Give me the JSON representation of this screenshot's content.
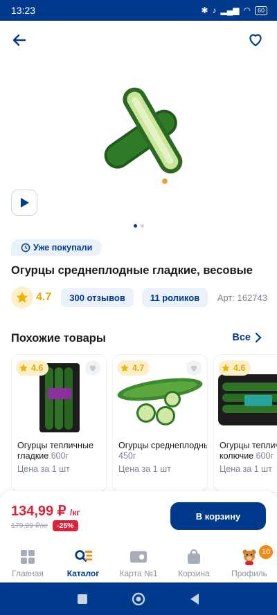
{
  "status": {
    "time": "13:23",
    "battery": "60"
  },
  "product": {
    "bought_label": "Уже покупали",
    "title": "Огурцы среднеплодные гладкие, весовые",
    "rating": "4.7",
    "reviews": "300 отзывов",
    "videos": "11 роликов",
    "article": "Арт: 162743"
  },
  "similar": {
    "title": "Похожие товары",
    "all_label": "Все",
    "cards": [
      {
        "rating": "4.6",
        "name": "Огурцы тепличные гладкие",
        "weight": "600г",
        "price_label": "Цена за 1 шт"
      },
      {
        "rating": "4.7",
        "name": "Огурцы среднеплодные",
        "weight": "450г",
        "price_label": "Цена за 1 шт"
      },
      {
        "rating": "4.6",
        "name": "Огурцы тепличные колючие",
        "weight": "600г",
        "price_label": "Цена за 1 шт"
      }
    ]
  },
  "price": {
    "current": "134,99 ₽",
    "unit": "/кг",
    "old": "179,99 ₽/кг",
    "discount": "-25%",
    "cart_label": "В корзину"
  },
  "tabs": [
    {
      "label": "Главная",
      "icon": "home-icon"
    },
    {
      "label": "Каталог",
      "icon": "catalog-search-icon"
    },
    {
      "label": "Карта №1",
      "icon": "loyalty-card-icon"
    },
    {
      "label": "Корзина",
      "icon": "cart-icon"
    },
    {
      "label": "Профиль",
      "icon": "profile-bear-icon",
      "badge": "10"
    }
  ],
  "colors": {
    "brand": "#003a8c",
    "accent_red": "#d9233a",
    "star": "#e7a800",
    "badge": "#f08a14"
  }
}
